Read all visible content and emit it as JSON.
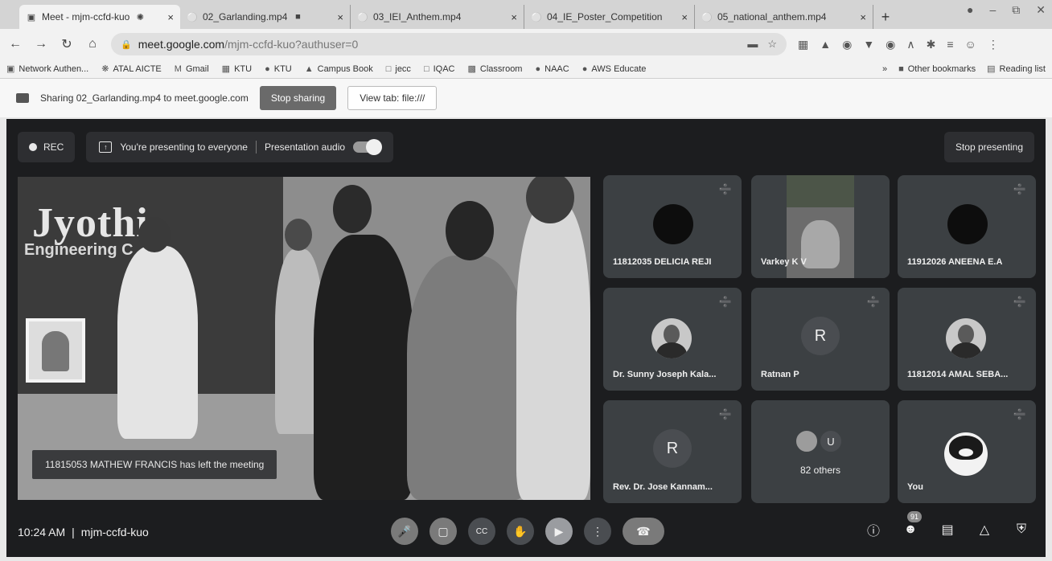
{
  "tabs": [
    {
      "title": "Meet - mjm-ccfd-kuo",
      "icon": "meet-icon",
      "active": true
    },
    {
      "title": "02_Garlanding.mp4",
      "icon": "globe-icon"
    },
    {
      "title": "03_IEI_Anthem.mp4",
      "icon": "globe-icon"
    },
    {
      "title": "04_IE_Poster_Competition",
      "icon": "globe-icon"
    },
    {
      "title": "05_national_anthem.mp4",
      "icon": "globe-icon"
    }
  ],
  "tab_close": "×",
  "new_tab": "+",
  "address": {
    "host": "meet.google.com",
    "path": "/mjm-ccfd-kuo?authuser=0"
  },
  "bookmarks": [
    {
      "label": "Network Authen...",
      "icon": "network-icon"
    },
    {
      "label": "ATAL AICTE",
      "icon": "atal-icon"
    },
    {
      "label": "Gmail",
      "icon": "gmail-icon"
    },
    {
      "label": "KTU",
      "icon": "ktu-icon"
    },
    {
      "label": "KTU",
      "icon": "globe-icon"
    },
    {
      "label": "Campus Book",
      "icon": "campus-icon"
    },
    {
      "label": "jecc",
      "icon": "doc-icon"
    },
    {
      "label": "IQAC",
      "icon": "doc-icon"
    },
    {
      "label": "Classroom",
      "icon": "classroom-icon"
    },
    {
      "label": "NAAC",
      "icon": "globe-icon"
    },
    {
      "label": "AWS Educate",
      "icon": "globe-icon"
    }
  ],
  "bookmarks_more": "»",
  "other_bookmarks": "Other bookmarks",
  "reading_list": "Reading list",
  "sharing": {
    "text": "Sharing 02_Garlanding.mp4 to meet.google.com",
    "stop_label": "Stop sharing",
    "view_label": "View tab: file:///"
  },
  "meet": {
    "rec_label": "REC",
    "presenting_text": "You're presenting to everyone",
    "audio_label": "Presentation audio",
    "stop_presenting": "Stop presenting",
    "stage_brand": "Jyothi",
    "stage_brand_sub": "Engineering C",
    "toast": "11815053 MATHEW FRANCIS has left the meeting",
    "participants": [
      {
        "name": "11812035 DELICIA REJI",
        "type": "dark"
      },
      {
        "name": "Varkey K V",
        "type": "video"
      },
      {
        "name": "11912026 ANEENA E.A",
        "type": "dark"
      },
      {
        "name": "Dr. Sunny Joseph Kala...",
        "type": "photo"
      },
      {
        "name": "Ratnan P",
        "type": "letter",
        "letter": "R"
      },
      {
        "name": "11812014 AMAL SEBA...",
        "type": "photo"
      },
      {
        "name": "Rev. Dr. Jose Kannam...",
        "type": "letter",
        "letter": "R"
      },
      {
        "name": "82 others",
        "type": "others",
        "letter": "U"
      },
      {
        "name": "You",
        "type": "penguin"
      }
    ],
    "time": "10:24 AM",
    "separator": "|",
    "code": "mjm-ccfd-kuo",
    "people_count": "91"
  }
}
